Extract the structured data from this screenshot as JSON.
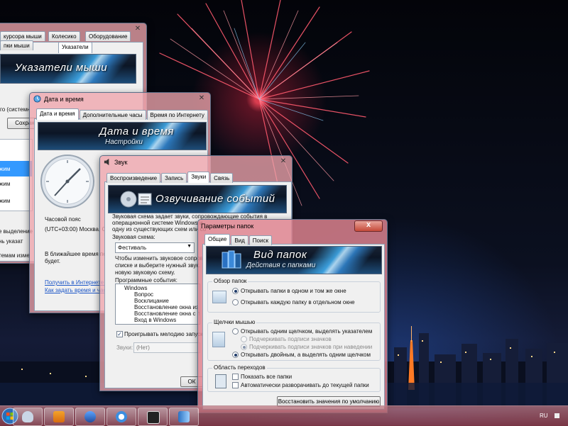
{
  "mouse_window": {
    "tabs": [
      "Колесико",
      "Оборудование",
      "Указатели"
    ],
    "tab_partial_1": "курсора мыши",
    "tab_partial_2": "пки мыши",
    "banner_title": "Указатели мыши",
    "scheme_value": "го (системн",
    "save_button": "Сохран",
    "list_items": [
      "жим",
      "жим",
      "жим"
    ],
    "selection_text": "е выделение",
    "pointer_text": "нь указат",
    "theme_text": "темам изме"
  },
  "datetime_window": {
    "title": "Дата и время",
    "tabs": [
      "Дата и время",
      "Дополнительные часы",
      "Время по Интернету"
    ],
    "banner_title": "Дата и время",
    "banner_subtitle": "Настройки",
    "timezone_label": "Часовой пояс",
    "timezone_value": "(UTC+03:00) Москва, Санк",
    "dst_text_1": "В ближайшее время пер",
    "dst_text_2": "будет.",
    "link_1": "Получить в Интернете св",
    "link_2": "Как задать время и часо"
  },
  "sound_window": {
    "title": "Звук",
    "tabs": [
      "Воспроизведение",
      "Запись",
      "Звуки",
      "Связь"
    ],
    "banner_title": "Озвучивание событий",
    "desc_lines": [
      "Звуковая схема задает звуки, сопровождающие события в",
      "операционной системе Windows и",
      "одну из существующих схем или со"
    ],
    "scheme_label": "Звуковая схема:",
    "scheme_value": "Фестиваль",
    "change_lines": [
      "Чтобы изменить звуковое сопрово",
      "списке и выберите нужный звук. И",
      "новую звуковую схему."
    ],
    "events_label": "Программные события:",
    "events": [
      "Windows",
      "Вопрос",
      "Восклицание",
      "Восстановление окна из з",
      "Восстановление окна с по",
      "Вход в Windows"
    ],
    "startup_checkbox": "Проигрывать мелодию запуска",
    "sounds_label": "Звуки:",
    "sounds_value": "(Нет)",
    "ok_button": "ОК"
  },
  "folder_window": {
    "title": "Параметры папок",
    "tabs": [
      "Общие",
      "Вид",
      "Поиск"
    ],
    "banner_title": "Вид папок",
    "banner_subtitle": "Действия с папками",
    "browse_group": "Обзор папок",
    "browse_options": [
      "Открывать папки в одном и том же окне",
      "Открывать каждую папку в отдельном окне"
    ],
    "click_group": "Щелчки мышью",
    "click_options": [
      "Открывать одним щелчком, выделять указателем",
      "Подчеркивать подписи значков",
      "Подчеркивать подписи значков при наведении",
      "Открывать двойным, а выделять одним щелчком"
    ],
    "nav_group": "Область переходов",
    "nav_options": [
      "Показать все папки",
      "Автоматически разворачивать до текущей папки"
    ],
    "restore_button": "Восстановить значения по умолчанию"
  },
  "taskbar": {
    "language": "RU",
    "buttons": [
      "mouse-icon",
      "media-player-icon",
      "mouse-settings-icon",
      "datetime-icon",
      "sound-icon",
      "folder-options-icon"
    ]
  }
}
